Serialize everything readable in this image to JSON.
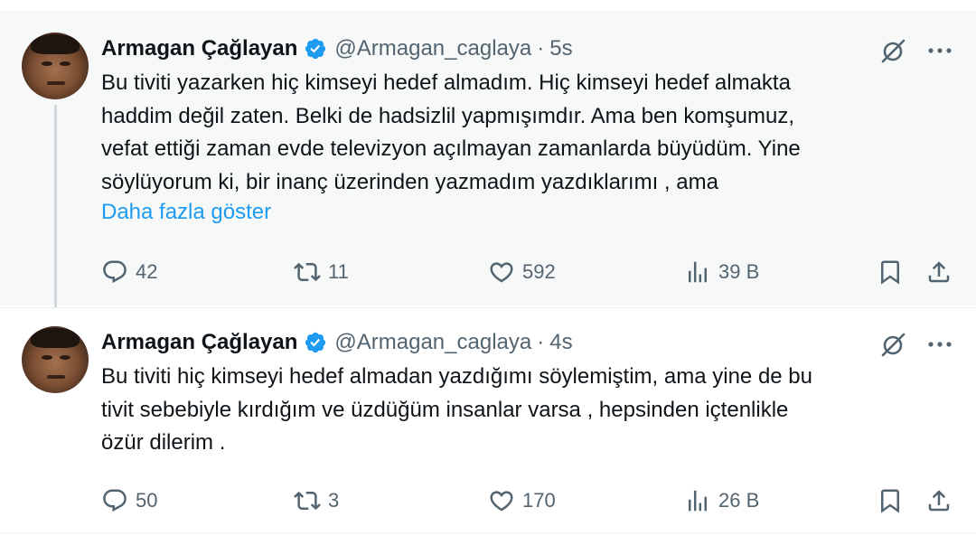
{
  "colors": {
    "accent": "#1d9bf0",
    "text": "#0f1419",
    "muted": "#536471",
    "highlight_bg": "#f7f9f9"
  },
  "tweets": [
    {
      "author_name": "Armagan Çağlayan",
      "handle": "@Armagan_caglaya",
      "separator": "·",
      "time": "5s",
      "body_lines": [
        "Bu tiviti yazarken hiç kimseyi hedef almadım. Hiç kimseyi hedef almakta",
        "haddim değil zaten. Belki de hadsizlil yapmışımdır. Ama ben komşumuz,",
        "vefat ettiği zaman evde televizyon açılmayan zamanlarda büyüdüm. Yine",
        "söylüyorum ki, bir inanç üzerinden yazmadım yazdıklarımı , ama"
      ],
      "show_more": "Daha fazla göster",
      "stats": {
        "replies": "42",
        "reposts": "11",
        "likes": "592",
        "views": "39 B"
      },
      "icons": [
        "verified-badge-icon",
        "grok-icon",
        "more-icon",
        "reply-icon",
        "repost-icon",
        "like-icon",
        "views-icon",
        "bookmark-icon",
        "share-icon"
      ]
    },
    {
      "author_name": "Armagan Çağlayan",
      "handle": "@Armagan_caglaya",
      "separator": "·",
      "time": "4s",
      "body_lines": [
        "Bu tiviti hiç kimseyi hedef almadan yazdığımı söylemiştim, ama yine de bu",
        "tivit sebebiyle kırdığım ve üzdüğüm insanlar varsa , hepsinden içtenlikle",
        "özür dilerim ."
      ],
      "stats": {
        "replies": "50",
        "reposts": "3",
        "likes": "170",
        "views": "26 B"
      }
    }
  ]
}
